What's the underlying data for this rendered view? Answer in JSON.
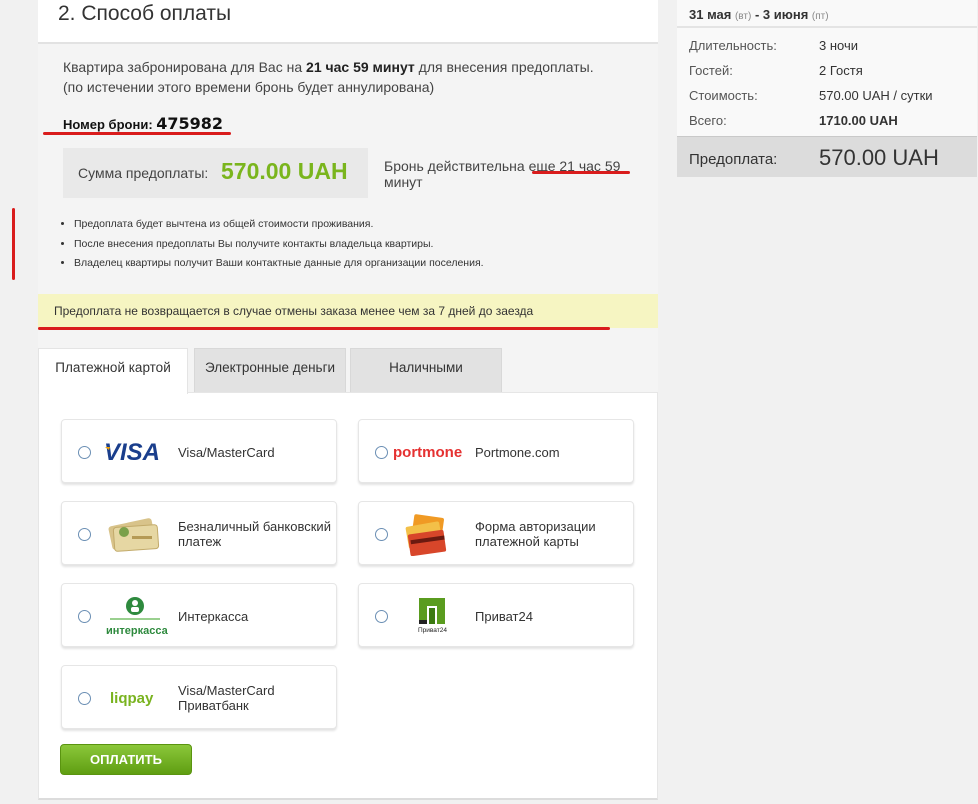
{
  "section_title": "2. Способ оплаты",
  "notice": {
    "part1": "Квартира забронирована для Вас на ",
    "time": "21 час 59 минут",
    "part2": " для внесения предоплаты. (по истечении этого времени бронь будет аннулирована)"
  },
  "booking": {
    "label": "Номер брони: ",
    "number": "475982"
  },
  "prepayment": {
    "label": "Сумма предоплаты:",
    "value": "570.00 UAH",
    "valid_text": "Бронь действительна еще 21 час 59 минут"
  },
  "notes": [
    "Предоплата будет вычтена из общей стоимости проживания.",
    "После внесения предоплаты Вы получите контакты владельца квартиры.",
    "Владелец квартиры получит Ваши контактные данные для организации поселения."
  ],
  "warning": "Предоплата не возвращается в случае отмены заказа менее чем за 7 дней до заезда",
  "tabs": [
    "Платежной картой",
    "Электронные деньги",
    "Наличными"
  ],
  "payment_options": [
    {
      "label": "Visa/MasterCard",
      "icon": "visa-logo",
      "logo_text": "VISA"
    },
    {
      "label": "Portmone.com",
      "icon": "portmone-logo",
      "logo_text": "portmone"
    },
    {
      "label": "Безналичный банковский платеж",
      "icon": "bank-transfer-icon"
    },
    {
      "label": "Форма авторизации платежной карты",
      "icon": "credit-cards-icon"
    },
    {
      "label": "Интеркасса",
      "icon": "interkassa-logo",
      "logo_text": "интеркасса"
    },
    {
      "label": "Приват24",
      "icon": "privat24-logo",
      "logo_text": "Приват24"
    },
    {
      "label": "Visa/MasterCard Приватбанк",
      "icon": "liqpay-logo",
      "logo_text": "liqpay"
    }
  ],
  "pay_button": "ОПЛАТИТЬ",
  "summary": {
    "date_from": "31 мая",
    "day_from": "(вт)",
    "dash": "-",
    "date_to": "3 июня",
    "day_to": "(пт)",
    "rows": [
      {
        "key": "Длительность:",
        "value": "3 ночи"
      },
      {
        "key": "Гостей:",
        "value": "2 Гостя"
      },
      {
        "key": "Стоимость:",
        "value": "570.00 UAH / сутки"
      },
      {
        "key": "Всего:",
        "value": "1710.00 UAH"
      }
    ],
    "prepay_label": "Предоплата:",
    "prepay_value": "570.00 UAH"
  },
  "colors": {
    "accent_green": "#7ab51d",
    "underline_red": "#d91c1c",
    "warning_bg": "#f6f5c2"
  }
}
